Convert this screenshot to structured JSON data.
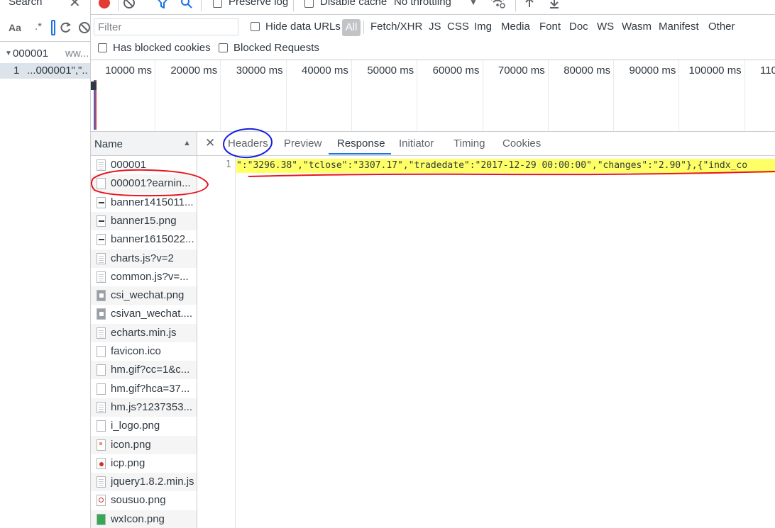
{
  "search_pane": {
    "tab_label": "Search",
    "match_case_label": "Aa",
    "regex_label": ".*",
    "result_file": "000001",
    "result_url": "ww...",
    "match_line_number": "1",
    "match_text": "...000001\",\"..."
  },
  "toolbar": {
    "preserve_log": "Preserve log",
    "disable_cache": "Disable cache",
    "throttling": "No throttling"
  },
  "filter": {
    "placeholder": "Filter",
    "hide_data_urls": "Hide data URLs",
    "types": [
      "All",
      "Fetch/XHR",
      "JS",
      "CSS",
      "Img",
      "Media",
      "Font",
      "Doc",
      "WS",
      "Wasm",
      "Manifest",
      "Other"
    ],
    "has_blocked_cookies": "Has blocked cookies",
    "blocked_requests": "Blocked Requests"
  },
  "timeline": {
    "ticks": [
      "10000 ms",
      "20000 ms",
      "30000 ms",
      "40000 ms",
      "50000 ms",
      "60000 ms",
      "70000 ms",
      "80000 ms",
      "90000 ms",
      "100000 ms",
      "110"
    ]
  },
  "requests": {
    "header": "Name",
    "items": [
      {
        "name": "000001",
        "icon": "doc"
      },
      {
        "name": "000001?earnin...",
        "icon": "blank"
      },
      {
        "name": "banner1415011...",
        "icon": "dark"
      },
      {
        "name": "banner15.png",
        "icon": "dark"
      },
      {
        "name": "banner1615022...",
        "icon": "dark"
      },
      {
        "name": "charts.js?v=2",
        "icon": "doc"
      },
      {
        "name": "common.js?v=...",
        "icon": "doc"
      },
      {
        "name": "csi_wechat.png",
        "icon": "img-g"
      },
      {
        "name": "csivan_wechat....",
        "icon": "img-g"
      },
      {
        "name": "echarts.min.js",
        "icon": "doc"
      },
      {
        "name": "favicon.ico",
        "icon": "blank"
      },
      {
        "name": "hm.gif?cc=1&c...",
        "icon": "blank"
      },
      {
        "name": "hm.gif?hca=37...",
        "icon": "blank"
      },
      {
        "name": "hm.js?1237353...",
        "icon": "doc"
      },
      {
        "name": "i_logo.png",
        "icon": "blank"
      },
      {
        "name": "icon.png",
        "icon": "img-icon"
      },
      {
        "name": "icp.png",
        "icon": "img-red"
      },
      {
        "name": "jquery1.8.2.min.js",
        "icon": "doc"
      },
      {
        "name": "sousuo.png",
        "icon": "img-search"
      },
      {
        "name": "wxIcon.png",
        "icon": "img-green"
      }
    ]
  },
  "detail": {
    "tabs": [
      "Headers",
      "Preview",
      "Response",
      "Initiator",
      "Timing",
      "Cookies"
    ],
    "active_tab": "Response",
    "line_number": "1",
    "response_line": "\":\"3296.38\",\"tclose\":\"3307.17\",\"tradedate\":\"2017-12-29 00:00:00\",\"changes\":\"2.90\"},{\"indx_co"
  },
  "colors": {
    "accent": "#1a73e8",
    "record": "#e53935",
    "highlight": "#ffff66",
    "annotation_red": "#e8141c",
    "annotation_blue": "#1520e0"
  }
}
